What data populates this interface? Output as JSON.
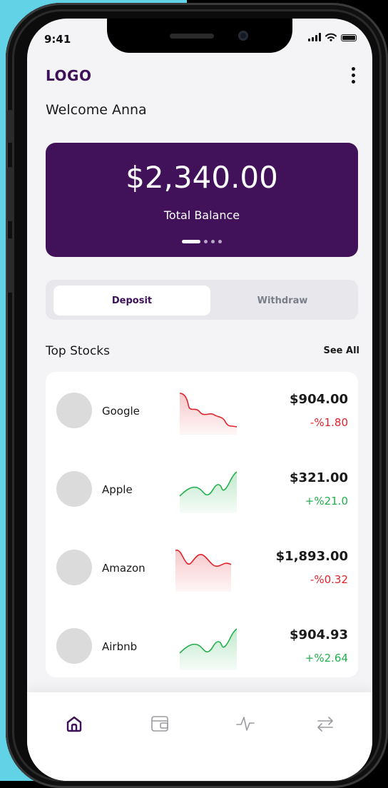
{
  "status_bar": {
    "time": "9:41"
  },
  "header": {
    "logo": "LOGO",
    "menu_icon": "kebab-menu-icon"
  },
  "welcome": "Welcome Anna",
  "balance": {
    "amount": "$2,340.00",
    "label": "Total Balance",
    "page_count": 4,
    "active_page": 1
  },
  "toggle": {
    "deposit_label": "Deposit",
    "withdraw_label": "Withdraw",
    "selected": "Deposit"
  },
  "stocks_section": {
    "title": "Top Stocks",
    "see_all": "See All"
  },
  "stocks": [
    {
      "name": "Google",
      "price": "$904.00",
      "change": "-%1.80",
      "trend": "down"
    },
    {
      "name": "Apple",
      "price": "$321.00",
      "change": "+%21.0",
      "trend": "up"
    },
    {
      "name": "Amazon",
      "price": "$1,893.00",
      "change": "-%0.32",
      "trend": "down"
    },
    {
      "name": "Airbnb",
      "price": "$904.93",
      "change": "+%2.64",
      "trend": "up"
    }
  ],
  "colors": {
    "brand": "#41125a",
    "negative": "#e2232a",
    "positive": "#22b14c",
    "background_accent": "#62d3e6"
  },
  "tabbar": {
    "tabs": [
      "home-icon",
      "wallet-icon",
      "activity-icon",
      "transfer-icon"
    ],
    "active": "home-icon"
  }
}
